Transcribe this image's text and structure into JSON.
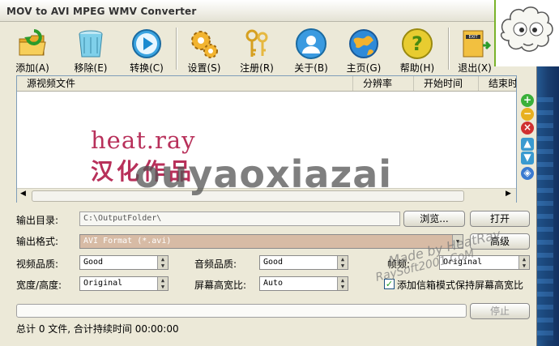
{
  "window": {
    "title": "MOV to AVI MPEG WMV Converter"
  },
  "toolbar": [
    {
      "id": "add",
      "label": "添加(A)",
      "icon": "folder-add-icon"
    },
    {
      "id": "remove",
      "label": "移除(E)",
      "icon": "trash-bin-icon"
    },
    {
      "id": "convert",
      "label": "转换(C)",
      "icon": "play-convert-icon"
    },
    {
      "id": "settings",
      "label": "设置(S)",
      "icon": "gears-icon"
    },
    {
      "id": "register",
      "label": "注册(R)",
      "icon": "keys-icon"
    },
    {
      "id": "about",
      "label": "关于(B)",
      "icon": "person-info-icon"
    },
    {
      "id": "home",
      "label": "主页(G)",
      "icon": "globe-icon"
    },
    {
      "id": "help",
      "label": "帮助(H)",
      "icon": "question-icon"
    },
    {
      "id": "exit",
      "label": "退出(X)",
      "icon": "exit-door-icon"
    }
  ],
  "list": {
    "columns": [
      "源视频文件",
      "分辨率",
      "开始时间",
      "结束时间"
    ]
  },
  "watermark": {
    "line1": "heat.ray",
    "line2": "汉化作品",
    "overlay": "ouyaoxiazai",
    "stamp1": "Made by HeatRay",
    "stamp2": "RaySoft2001.CoM"
  },
  "output_dir": {
    "label": "输出目录:",
    "value": "C:\\OutputFolder\\",
    "browse": "浏览...",
    "open": "打开"
  },
  "output_format": {
    "label": "输出格式:",
    "value": "AVI Format (*.avi)",
    "advanced": "高级"
  },
  "video_quality": {
    "label": "视频品质:",
    "value": "Good"
  },
  "audio_quality": {
    "label": "音频品质:",
    "value": "Good"
  },
  "frame_rate": {
    "label": "帧频:",
    "value": "Original"
  },
  "size": {
    "label": "宽度/高度:",
    "value": "Original"
  },
  "aspect": {
    "label": "屏幕高宽比:",
    "value": "Auto"
  },
  "letterbox": {
    "label": "添加信箱模式保持屏幕高宽比",
    "checked": true
  },
  "stop_button": "停止",
  "status": "总计 0 文件, 合计持续时间 00:00:00"
}
